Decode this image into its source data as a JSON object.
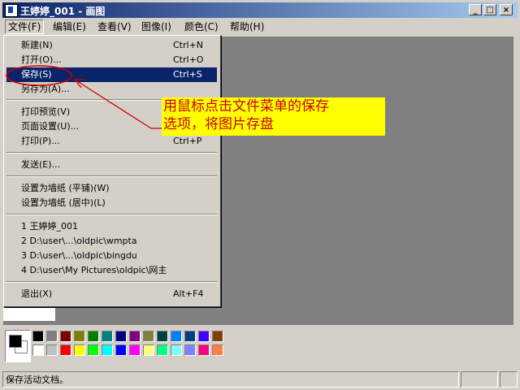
{
  "window": {
    "title": "王婷婷_001 - 画图",
    "min_label": "_",
    "max_label": "□",
    "close_label": "×"
  },
  "menubar": [
    {
      "label": "文件(F)",
      "active": true
    },
    {
      "label": "编辑(E)"
    },
    {
      "label": "查看(V)"
    },
    {
      "label": "图像(I)"
    },
    {
      "label": "颜色(C)"
    },
    {
      "label": "帮助(H)"
    }
  ],
  "file_menu": {
    "new": {
      "label": "新建(N)",
      "shortcut": "Ctrl+N"
    },
    "open": {
      "label": "打开(O)...",
      "shortcut": "Ctrl+O"
    },
    "save": {
      "label": "保存(S)",
      "shortcut": "Ctrl+S"
    },
    "save_as": {
      "label": "另存为(A)..."
    },
    "print_preview": {
      "label": "打印预览(V)"
    },
    "page_setup": {
      "label": "页面设置(U)..."
    },
    "print": {
      "label": "打印(P)...",
      "shortcut": "Ctrl+P"
    },
    "send": {
      "label": "发送(E)..."
    },
    "wallpaper_tile": {
      "label": "设置为墙纸 (平铺)(W)"
    },
    "wallpaper_center": {
      "label": "设置为墙纸 (居中)(L)"
    },
    "recent": [
      "1 王婷婷_001",
      "2 D:\\user\\...\\oldpic\\wmpta",
      "3 D:\\user\\...\\oldpic\\bingdu",
      "4 D:\\user\\My Pictures\\oldpic\\网主"
    ],
    "exit": {
      "label": "退出(X)",
      "shortcut": "Alt+F4"
    }
  },
  "annotation": {
    "line1": "用鼠标点击文件菜单的保存",
    "line2": "选项，将图片存盘",
    "color": "#cc0000",
    "bg": "#ffff00"
  },
  "palette": {
    "foreground": "#000000",
    "background": "#ffffff",
    "row1": [
      "#000000",
      "#808080",
      "#800000",
      "#808000",
      "#008000",
      "#008080",
      "#000080",
      "#800080",
      "#808040",
      "#004040",
      "#0080ff",
      "#004080",
      "#4000ff",
      "#804000"
    ],
    "row2": [
      "#ffffff",
      "#c0c0c0",
      "#ff0000",
      "#ffff00",
      "#00ff00",
      "#00ffff",
      "#0000ff",
      "#ff00ff",
      "#ffff80",
      "#00ff80",
      "#80ffff",
      "#8080ff",
      "#ff0080",
      "#ff8040"
    ]
  },
  "status": {
    "text": "保存活动文档。"
  }
}
